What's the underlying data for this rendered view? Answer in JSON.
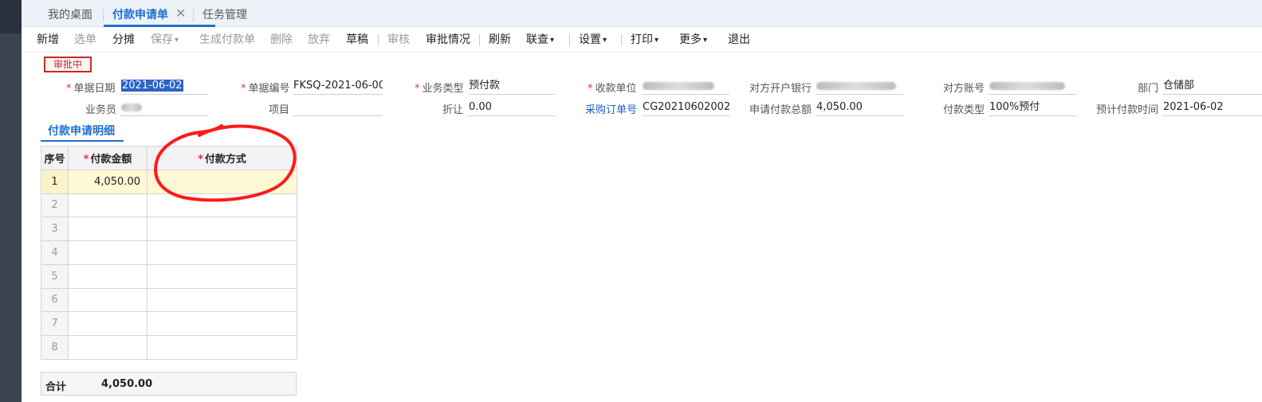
{
  "tabs": [
    {
      "label": "我的桌面",
      "active": false
    },
    {
      "label": "付款申请单",
      "active": true
    },
    {
      "label": "任务管理",
      "active": false
    }
  ],
  "toolbar": {
    "add": "新增",
    "select": "选单",
    "allocate": "分摊",
    "save": "保存",
    "gen_payment": "生成付款单",
    "delete": "删除",
    "discard": "放弃",
    "draft": "草稿",
    "audit": "审核",
    "approval": "审批情况",
    "refresh": "刷新",
    "linked": "联查",
    "settings": "设置",
    "print": "打印",
    "more": "更多",
    "exit": "退出"
  },
  "status": "审批中",
  "form": {
    "doc_date_label": "单据日期",
    "doc_date": "2021-06-02",
    "doc_no_label": "单据编号",
    "doc_no": "FKSQ-2021-06-00...",
    "biz_type_label": "业务类型",
    "biz_type": "预付款",
    "payee_label": "收款单位",
    "bank_label": "对方开户银行",
    "account_label": "对方账号",
    "dept_label": "部门",
    "dept": "仓储部",
    "staff_label": "业务员",
    "project_label": "项目",
    "discount_label": "折让",
    "discount": "0.00",
    "po_label": "采购订单号",
    "po": "CG20210602002",
    "total_label": "申请付款总额",
    "total": "4,050.00",
    "pay_type_label": "付款类型",
    "pay_type": "100%预付",
    "expected_label": "预计付款时间",
    "expected": "2021-06-02"
  },
  "detail": {
    "tab": "付款申请明细",
    "columns": [
      "序号",
      "付款金额",
      "付款方式"
    ],
    "rows": [
      {
        "idx": "1",
        "amount": "4,050.00",
        "method": ""
      },
      {
        "idx": "2",
        "amount": "",
        "method": ""
      },
      {
        "idx": "3",
        "amount": "",
        "method": ""
      },
      {
        "idx": "4",
        "amount": "",
        "method": ""
      },
      {
        "idx": "5",
        "amount": "",
        "method": ""
      },
      {
        "idx": "6",
        "amount": "",
        "method": ""
      },
      {
        "idx": "7",
        "amount": "",
        "method": ""
      },
      {
        "idx": "8",
        "amount": "",
        "method": ""
      }
    ],
    "total_label": "合计",
    "total_value": "4,050.00"
  },
  "colors": {
    "accent": "#1f6fd0",
    "required": "#e03131",
    "annotation": "#ff1a1a",
    "active_row": "#fff8d5"
  }
}
